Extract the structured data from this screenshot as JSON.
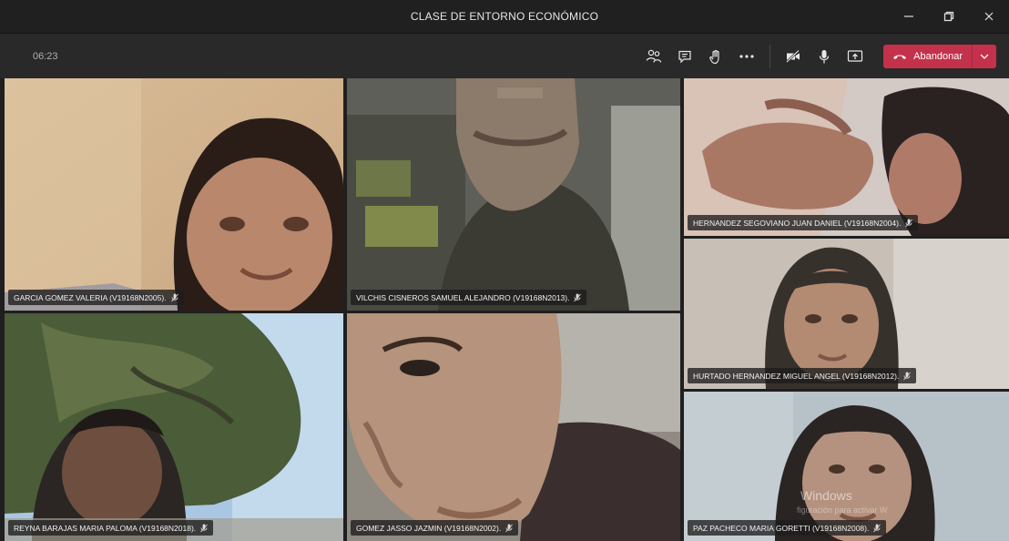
{
  "window": {
    "title": "CLASE DE ENTORNO ECONÓMICO"
  },
  "toolbar": {
    "timer": "06:23",
    "icons": [
      "participants-icon",
      "chat-icon",
      "raise-hand-icon",
      "more-options-icon",
      "camera-off-icon",
      "microphone-icon",
      "share-screen-icon"
    ],
    "leave_label": "Abandonar",
    "leave_color": "#c4314b"
  },
  "participants": [
    {
      "name": "GARCIA GOMEZ VALERIA (V19168N2005)."
    },
    {
      "name": "VILCHIS CISNEROS SAMUEL ALEJANDRO (V19168N2013)."
    },
    {
      "name": "HERNANDEZ SEGOVIANO JUAN DANIEL (V19168N2004)."
    },
    {
      "name": "HURTADO HERNANDEZ MIGUEL ANGEL (V19168N2012)."
    },
    {
      "name": "REYNA BARAJAS MARIA PALOMA (V19168N2018)."
    },
    {
      "name": "GOMEZ JASSO JAZMIN (V19168N2002)."
    },
    {
      "name": "PAZ PACHECO MARIA GORETTI (V19168N2008)."
    }
  ],
  "watermark": {
    "text": "Windows",
    "subtext": "figuración para activar W"
  }
}
